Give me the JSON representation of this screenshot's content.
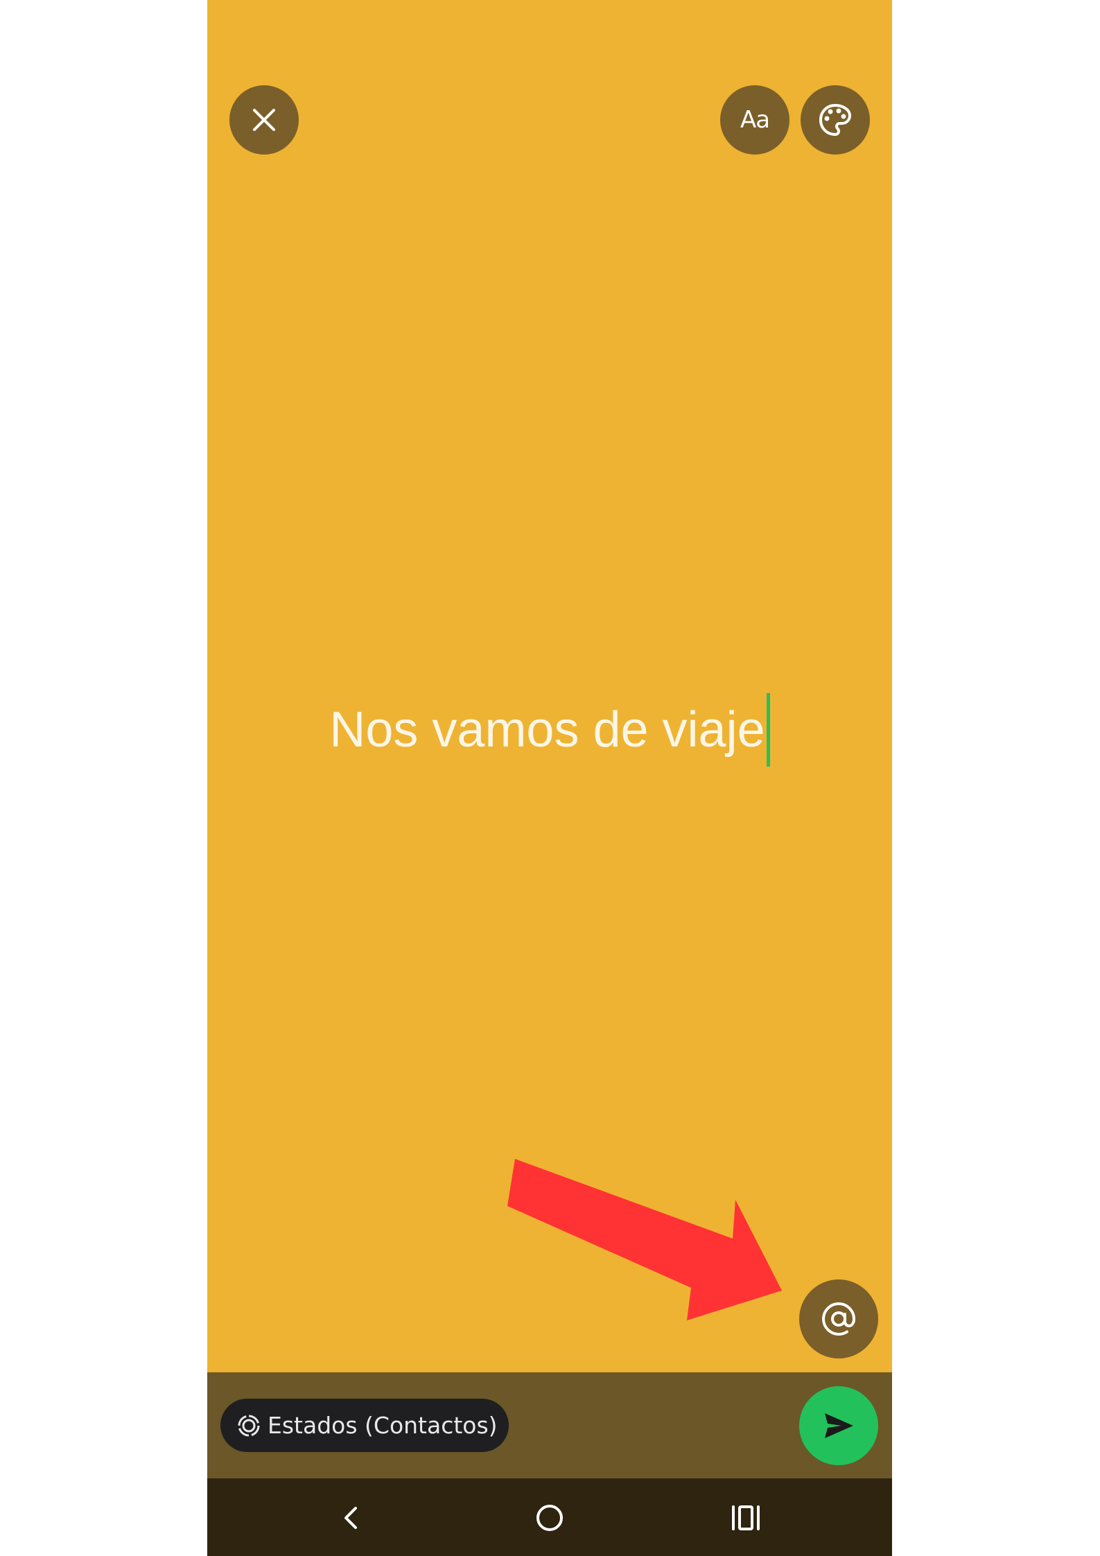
{
  "toolbar": {
    "close_icon": "close-icon",
    "font_label": "Aa",
    "palette_icon": "palette-icon"
  },
  "composer": {
    "text": "Nos vamos de viaje",
    "background_color": "#eeb332",
    "caret_color": "#28c05a"
  },
  "mention": {
    "icon": "at-sign-icon"
  },
  "footer": {
    "audience_label": "Estados (Contactos)",
    "audience_icon": "status-icon",
    "send_icon": "send-icon",
    "send_color": "#23c15c"
  },
  "navigation": {
    "back_icon": "back-icon",
    "home_icon": "home-icon",
    "recents_icon": "recents-icon"
  },
  "annotation": {
    "arrow_color": "#ff3333"
  }
}
